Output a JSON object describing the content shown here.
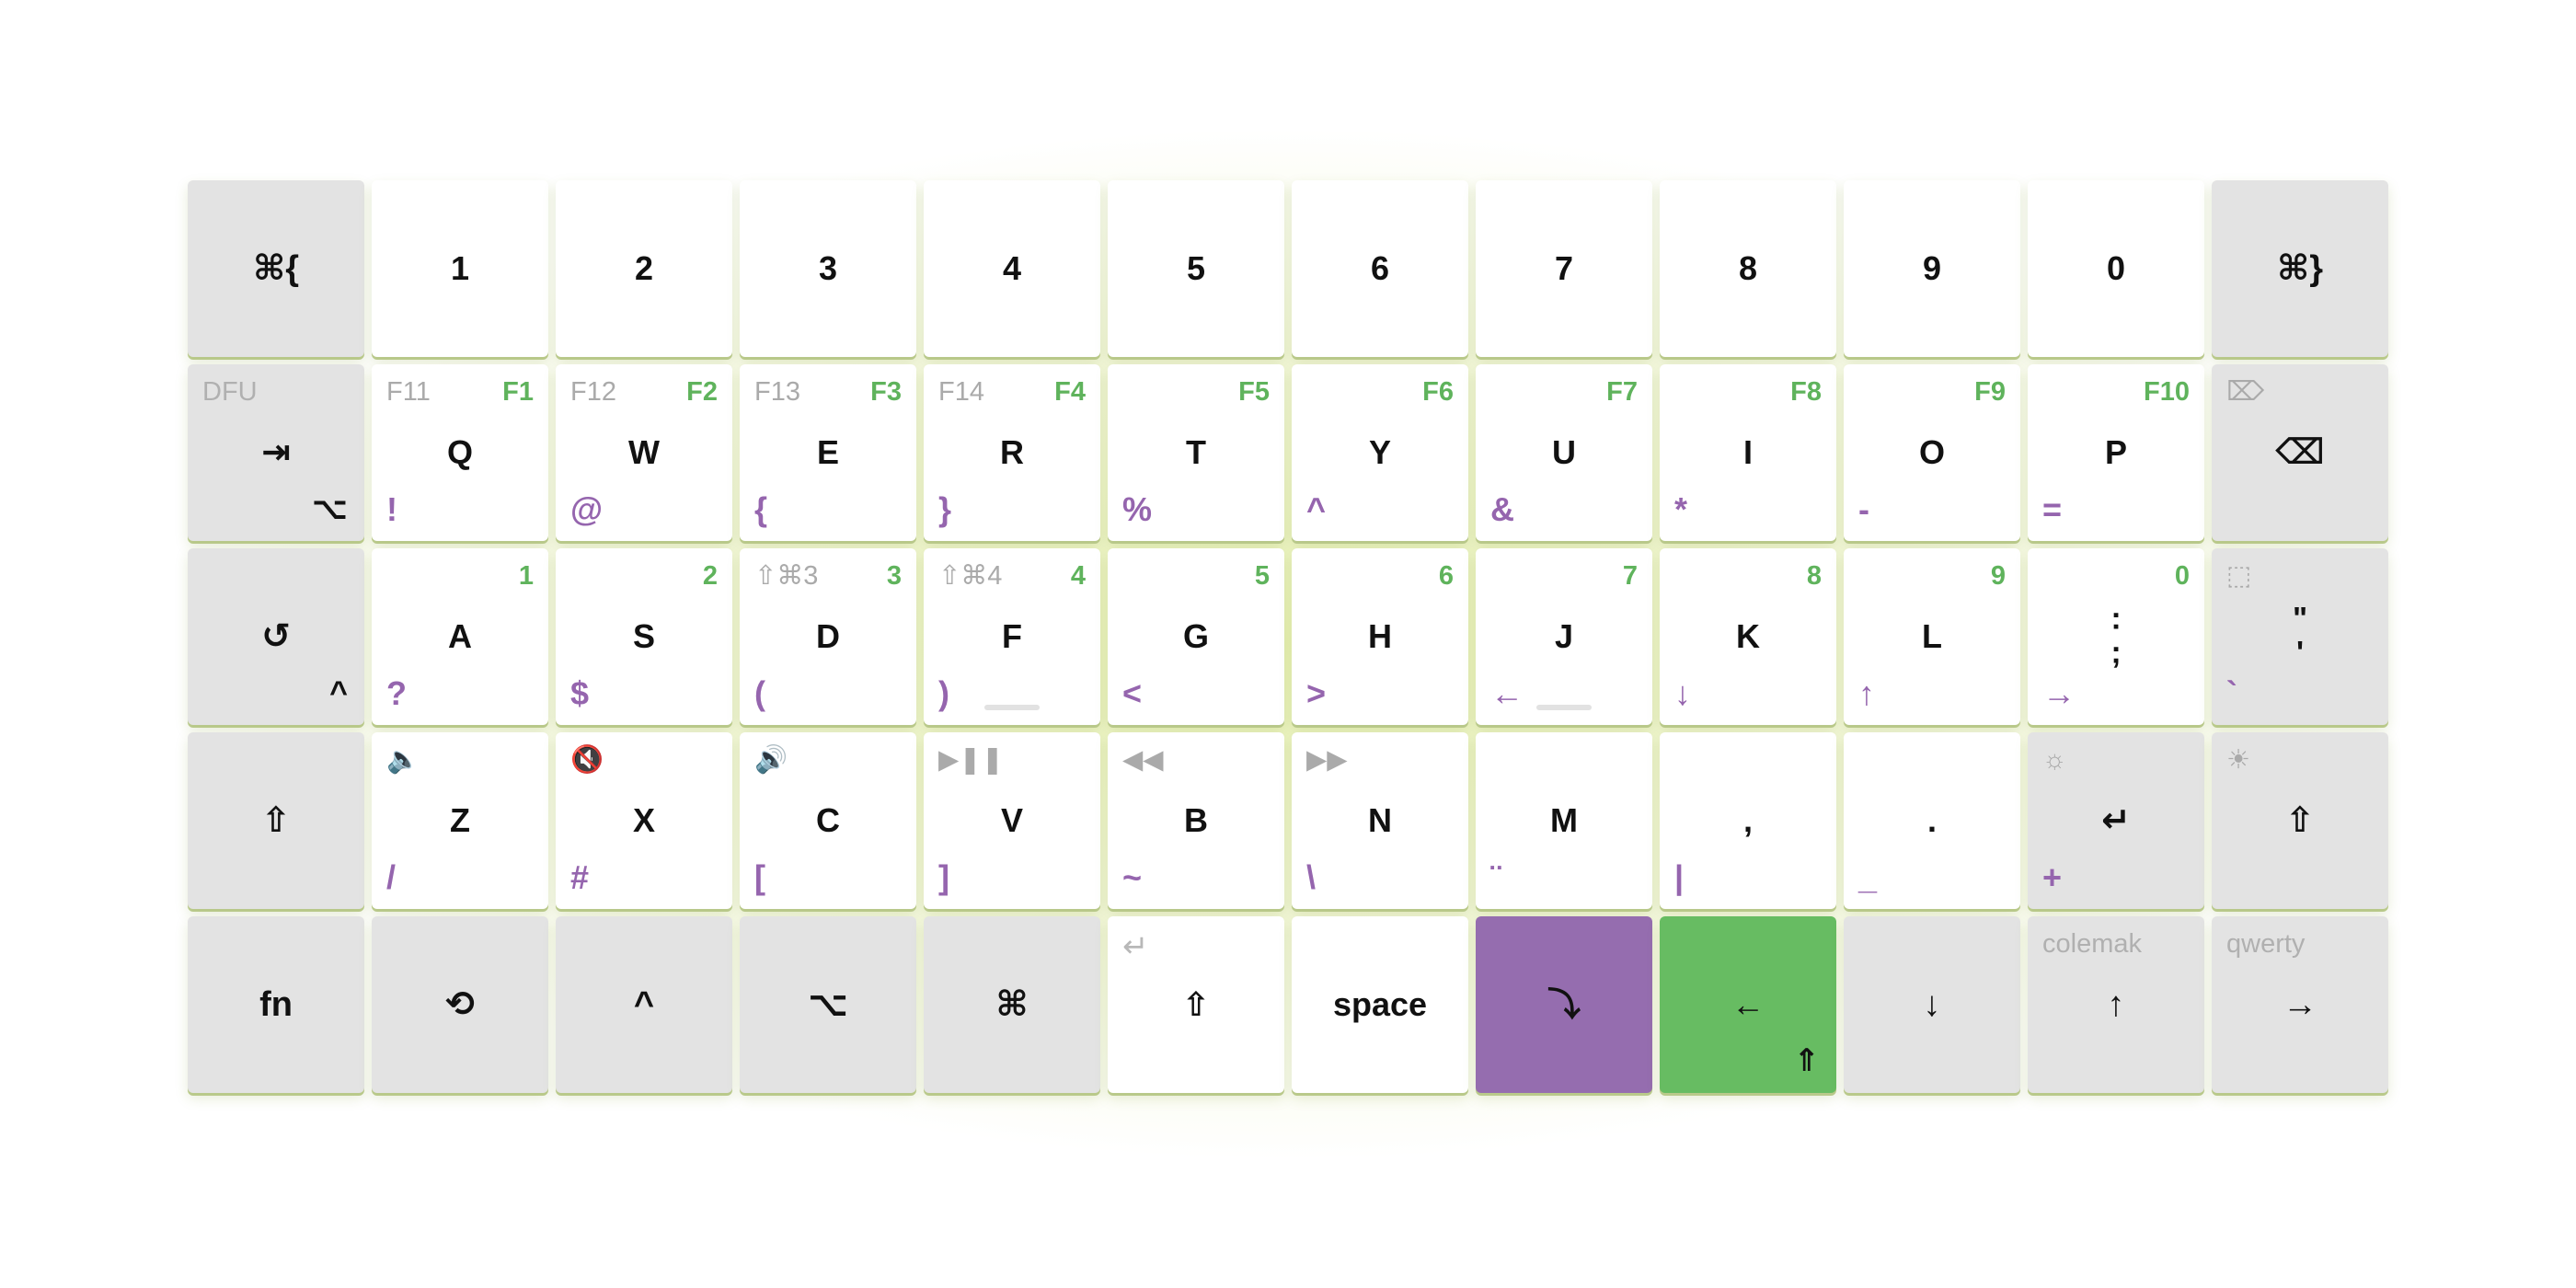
{
  "colors": {
    "layer_purple": "#956daf",
    "layer_green": "#67bc62",
    "modifier_key": "#e3e3e3",
    "alpha_key": "#ffffff"
  },
  "keyboard": {
    "rows": [
      [
        {
          "main": "⌘{",
          "type": "mod"
        },
        {
          "main": "1"
        },
        {
          "main": "2"
        },
        {
          "main": "3"
        },
        {
          "main": "4"
        },
        {
          "main": "5"
        },
        {
          "main": "6"
        },
        {
          "main": "7"
        },
        {
          "main": "8"
        },
        {
          "main": "9"
        },
        {
          "main": "0"
        },
        {
          "main": "⌘}",
          "type": "mod"
        }
      ],
      [
        {
          "main": "⇥",
          "type": "mod",
          "tl": "DFU",
          "br": "⌥"
        },
        {
          "main": "Q",
          "tl": "F11",
          "tr": "F1",
          "bl": "!"
        },
        {
          "main": "W",
          "tl": "F12",
          "tr": "F2",
          "bl": "@"
        },
        {
          "main": "E",
          "tl": "F13",
          "tr": "F3",
          "bl": "{"
        },
        {
          "main": "R",
          "tl": "F14",
          "tr": "F4",
          "bl": "}"
        },
        {
          "main": "T",
          "tr": "F5",
          "bl": "%"
        },
        {
          "main": "Y",
          "tr": "F6",
          "bl": "^"
        },
        {
          "main": "U",
          "tr": "F7",
          "bl": "&"
        },
        {
          "main": "I",
          "tr": "F8",
          "bl": "*"
        },
        {
          "main": "O",
          "tr": "F9",
          "bl": "-"
        },
        {
          "main": "P",
          "tr": "F10",
          "bl": "="
        },
        {
          "main": "⌫",
          "type": "mod",
          "tl": "⌦"
        }
      ],
      [
        {
          "main": "↺",
          "type": "mod",
          "br": "^"
        },
        {
          "main": "A",
          "tr": "1",
          "bl": "?"
        },
        {
          "main": "S",
          "tr": "2",
          "bl": "$"
        },
        {
          "main": "D",
          "tl": "⇧⌘3",
          "tr": "3",
          "bl": "("
        },
        {
          "main": "F",
          "tl": "⇧⌘4",
          "tr": "4",
          "bl": ")",
          "home": true
        },
        {
          "main": "G",
          "tr": "5",
          "bl": "<"
        },
        {
          "main": "H",
          "tr": "6",
          "bl": ">"
        },
        {
          "main": "J",
          "tr": "7",
          "bl": "←",
          "home": true
        },
        {
          "main": "K",
          "tr": "8",
          "bl": "↓"
        },
        {
          "main": "L",
          "tr": "9",
          "bl": "↑"
        },
        {
          "main": ":\n;",
          "tr": "0",
          "bl": "→"
        },
        {
          "main": "\"\n'",
          "type": "mod",
          "tl": "⬚",
          "bl": "`"
        }
      ],
      [
        {
          "main": "⇧",
          "type": "mod"
        },
        {
          "main": "Z",
          "tl": "🔈",
          "bl": "/"
        },
        {
          "main": "X",
          "tl": "🔇",
          "bl": "#"
        },
        {
          "main": "C",
          "tl": "🔊",
          "bl": "["
        },
        {
          "main": "V",
          "tl": "▶❚❚",
          "bl": "]"
        },
        {
          "main": "B",
          "tl": "◀◀",
          "bl": "~"
        },
        {
          "main": "N",
          "tl": "▶▶",
          "bl": "\\"
        },
        {
          "main": "M",
          "bl": "¨"
        },
        {
          "main": ",",
          "bl": "|"
        },
        {
          "main": ".",
          "bl": "_"
        },
        {
          "main": "↵",
          "type": "mod",
          "tl": "☼",
          "bl": "+"
        },
        {
          "main": "⇧",
          "type": "mod",
          "tl": "☀"
        }
      ],
      [
        {
          "main": "fn",
          "type": "mod"
        },
        {
          "main": "⟲",
          "type": "mod"
        },
        {
          "main": "^",
          "type": "mod"
        },
        {
          "main": "⌥",
          "type": "mod"
        },
        {
          "main": "⌘",
          "type": "mod"
        },
        {
          "main": "⇧",
          "tl": "↵"
        },
        {
          "main": "space"
        },
        {
          "main": "⤵",
          "type": "purple"
        },
        {
          "main": "←",
          "type": "green",
          "br": "⇑"
        },
        {
          "main": "↓",
          "type": "mod"
        },
        {
          "main": "↑",
          "type": "mod",
          "tl": "colemak"
        },
        {
          "main": "→",
          "type": "mod",
          "tl": "qwerty"
        }
      ]
    ]
  }
}
